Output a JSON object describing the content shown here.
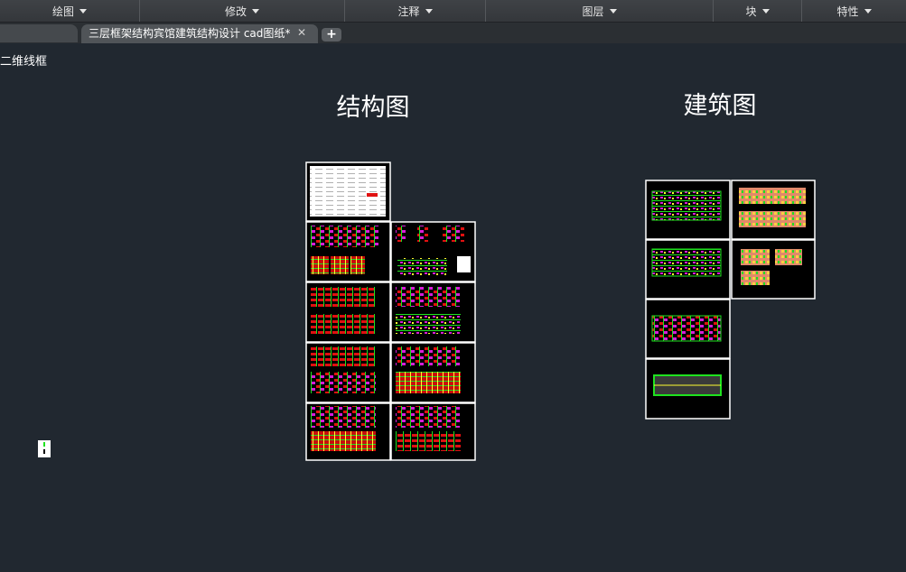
{
  "ribbon": {
    "panels": [
      "绘图",
      "修改",
      "注释",
      "图层",
      "块",
      "特性"
    ]
  },
  "tabs": {
    "active_label": "三层框架结构宾馆建筑结构设计 cad图纸*",
    "close_glyph": "✕",
    "add_glyph": "+"
  },
  "viewport": {
    "view_label": "二维线框"
  },
  "drawing": {
    "structure_title": "结构图",
    "architecture_title": "建筑图"
  },
  "colors": {
    "canvas_bg": "#212830",
    "sheet_border": "#ffffff",
    "plan_green": "#1fe21f",
    "plan_red": "#e01010",
    "plan_magenta": "#d81bd8",
    "plan_yellow": "#ffff30"
  }
}
